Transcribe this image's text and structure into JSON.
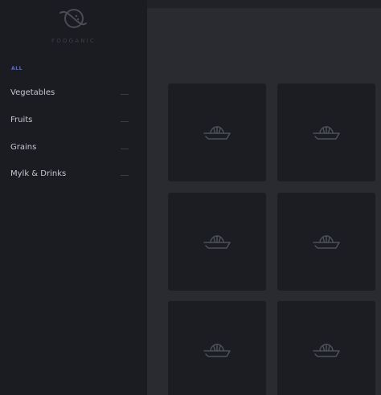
{
  "brand": {
    "name": "FOOGANIC"
  },
  "sidebar": {
    "filter_all": "ALL",
    "items": [
      {
        "label": "Vegetables"
      },
      {
        "label": "Fruits"
      },
      {
        "label": "Grains"
      },
      {
        "label": "Mylk & Drinks"
      }
    ]
  },
  "products": [
    {
      "icon": "juicer-icon"
    },
    {
      "icon": "juicer-icon"
    },
    {
      "icon": "juicer-icon"
    },
    {
      "icon": "juicer-icon"
    },
    {
      "icon": "juicer-icon"
    },
    {
      "icon": "juicer-icon"
    }
  ],
  "colors": {
    "sidebar_bg": "#1b1c21",
    "main_bg": "#2a2b31",
    "card_bg": "#1c1d22",
    "accent": "#5b6bd8",
    "icon": "#4d5059"
  }
}
